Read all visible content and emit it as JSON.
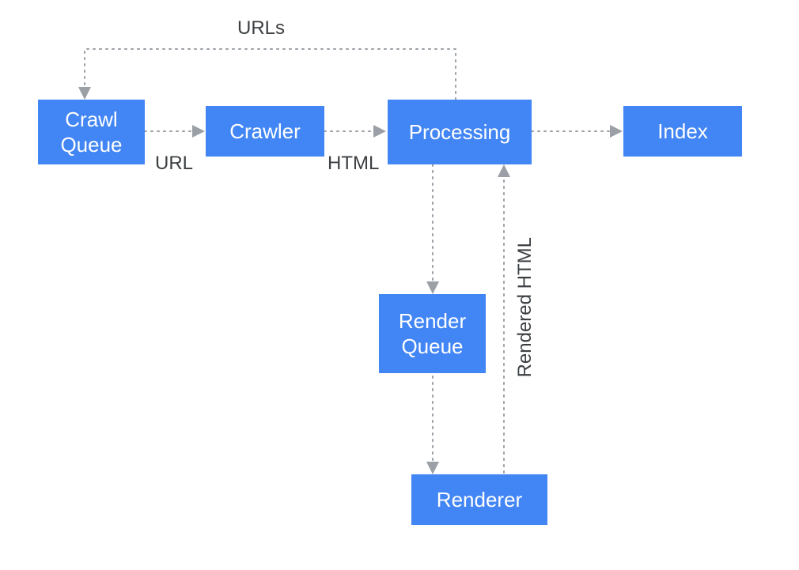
{
  "diagram": {
    "nodes": {
      "crawl_queue": "Crawl\nQueue",
      "crawler": "Crawler",
      "processing": "Processing",
      "index": "Index",
      "render_queue": "Render\nQueue",
      "renderer": "Renderer"
    },
    "edge_labels": {
      "urls_top": "URLs",
      "url": "URL",
      "html": "HTML",
      "rendered_html": "Rendered HTML"
    },
    "colors": {
      "node_fill": "#4285f4",
      "node_shadow": "#d2e3fc",
      "text_dark": "#3c4043",
      "arrow": "#9aa0a6"
    }
  }
}
